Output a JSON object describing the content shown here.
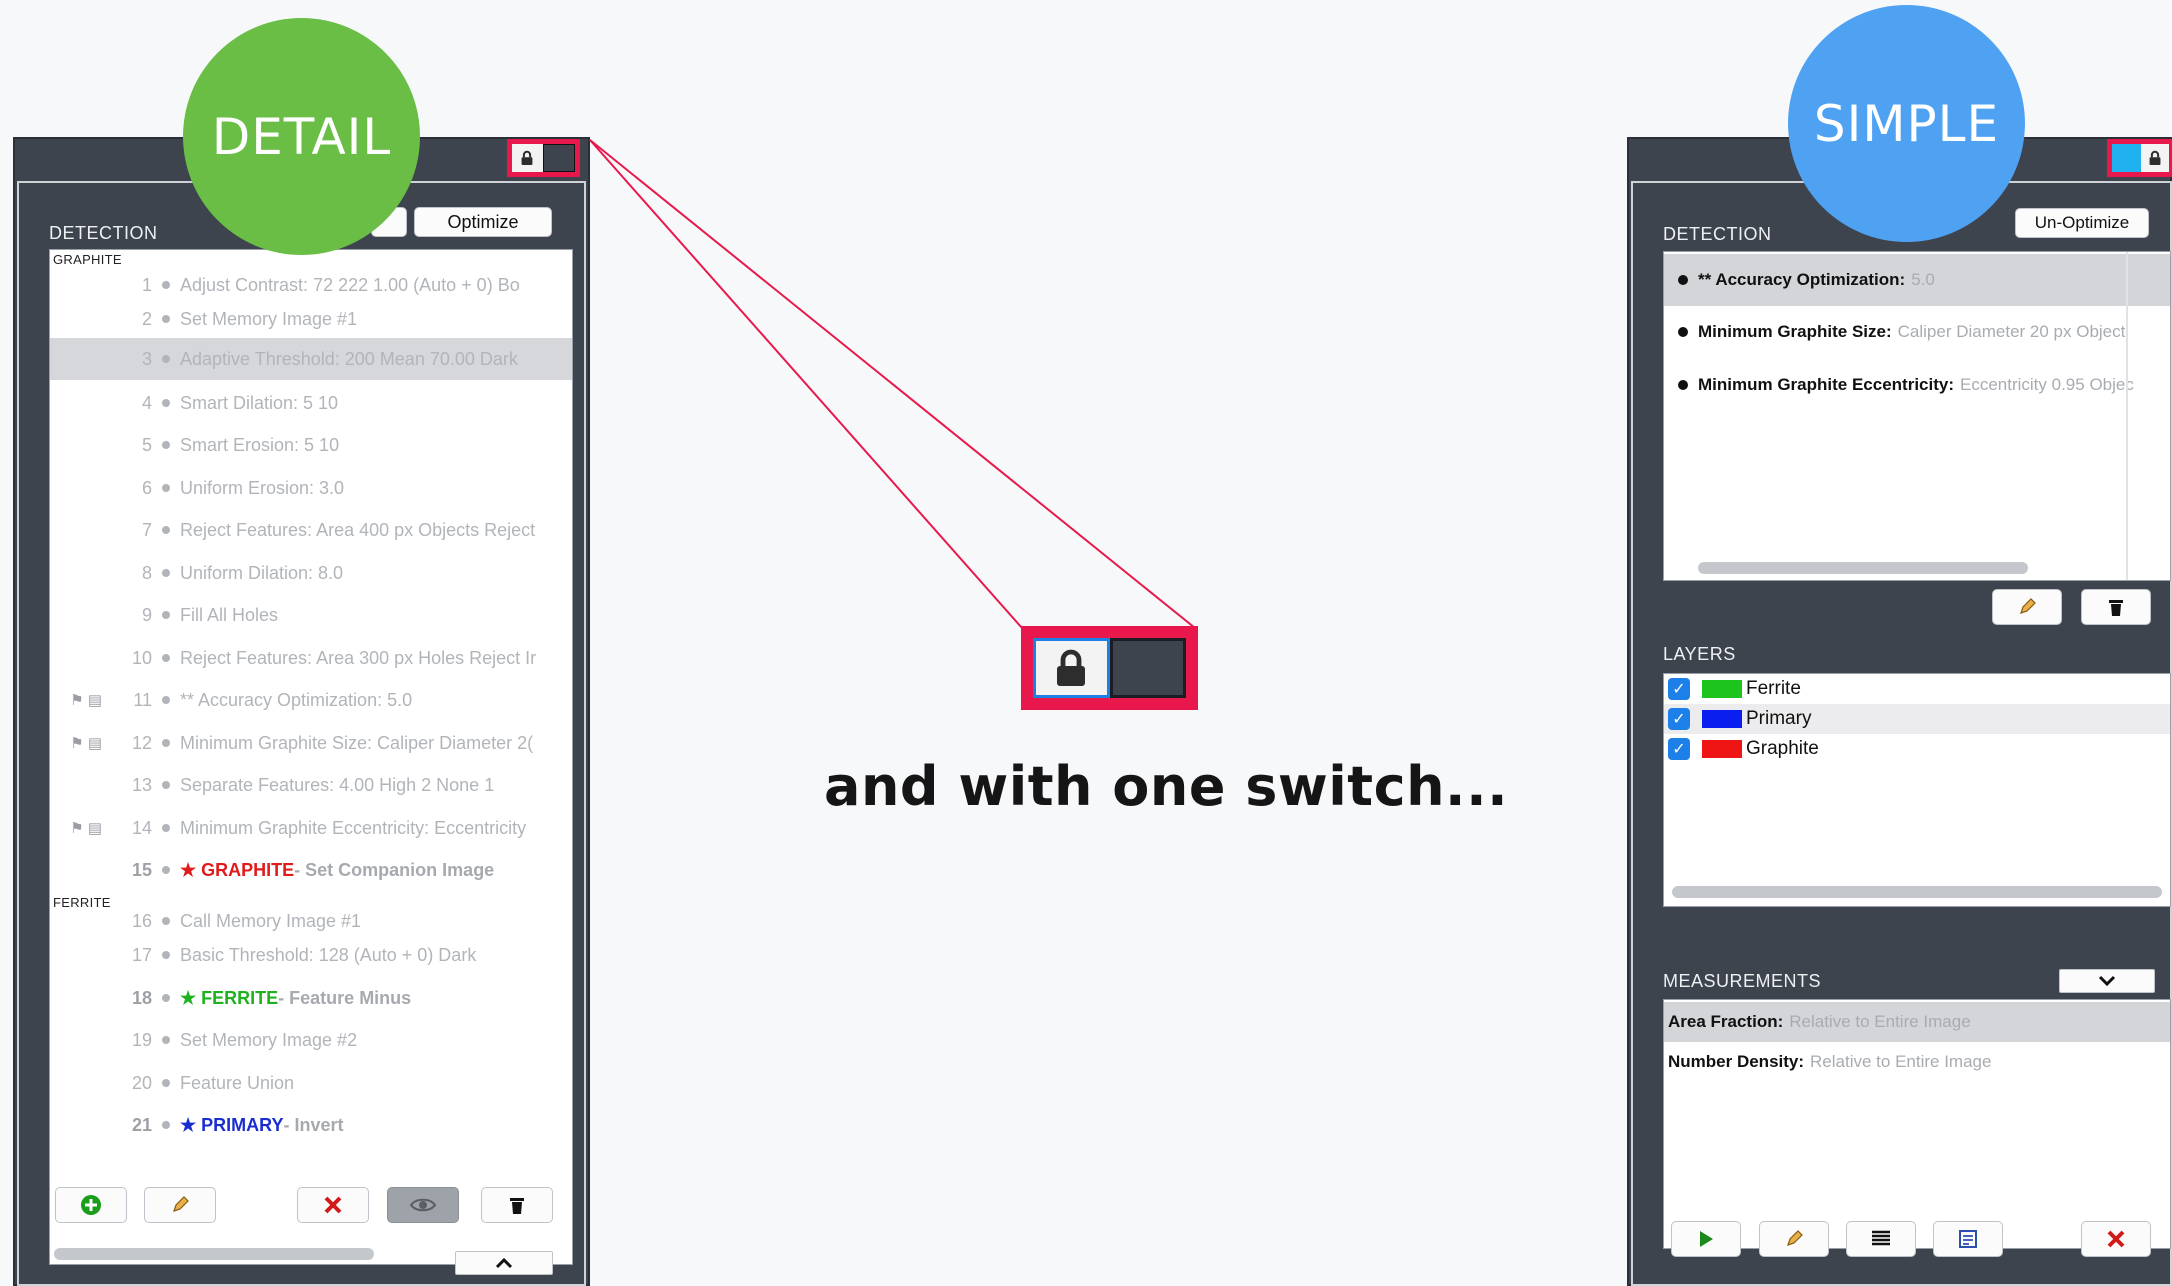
{
  "badges": {
    "detail": "DETAIL",
    "simple": "SIMPLE"
  },
  "tagline": "and with one switch...",
  "colors": {
    "accent_red": "#e8184d",
    "detail_badge": "#6abd45",
    "simple_badge": "#4fa2f2",
    "panel": "#3d444e"
  },
  "detail_panel": {
    "section_label": "DETECTION",
    "optimize_label": "Optimize",
    "groups": {
      "graphite": "GRAPHITE",
      "ferrite": "FERRITE"
    },
    "steps": [
      {
        "num": "1",
        "text": "Adjust Contrast: 72 222 1.00 (Auto + 0) Bo"
      },
      {
        "num": "2",
        "text": "Set Memory Image #1"
      },
      {
        "num": "3",
        "text": "Adaptive Threshold: 200 Mean 70.00 Dark"
      },
      {
        "num": "4",
        "text": "Smart Dilation: 5 10"
      },
      {
        "num": "5",
        "text": "Smart Erosion: 5 10"
      },
      {
        "num": "6",
        "text": "Uniform Erosion: 3.0"
      },
      {
        "num": "7",
        "text": "Reject Features: Area 400 px Objects Reject"
      },
      {
        "num": "8",
        "text": "Uniform Dilation: 8.0"
      },
      {
        "num": "9",
        "text": "Fill All Holes"
      },
      {
        "num": "10",
        "text": "Reject Features: Area 300 px Holes Reject Ir"
      },
      {
        "num": "11",
        "text": "** Accuracy Optimization: 5.0"
      },
      {
        "num": "12",
        "text": "Minimum Graphite Size: Caliper Diameter 2("
      },
      {
        "num": "13",
        "text": "Separate Features: 4.00 High 2 None 1"
      },
      {
        "num": "14",
        "text": "Minimum Graphite Eccentricity: Eccentricity"
      },
      {
        "num": "15",
        "star": "★",
        "name": "GRAPHITE",
        "text": " - Set Companion Image"
      },
      {
        "num": "16",
        "text": "Call Memory Image #1"
      },
      {
        "num": "17",
        "text": "Basic Threshold: 128 (Auto + 0) Dark"
      },
      {
        "num": "18",
        "star": "★",
        "name": "FERRITE",
        "text": " - Feature Minus"
      },
      {
        "num": "19",
        "text": "Set Memory Image #2"
      },
      {
        "num": "20",
        "text": "Feature Union"
      },
      {
        "num": "21",
        "star": "★",
        "name": "PRIMARY",
        "text": " - Invert"
      }
    ],
    "flag_glyph": "⚑ ▤",
    "icons": [
      "add-icon",
      "pencil-icon",
      "delete-x-icon",
      "eye-icon",
      "trash-icon",
      "chevron-up-icon"
    ]
  },
  "simple_panel": {
    "section_label": "DETECTION",
    "unoptimize_label": "Un-Optimize",
    "detection_items": [
      {
        "key": "** Accuracy Optimization:",
        "value": "5.0"
      },
      {
        "key": "Minimum Graphite Size:",
        "value": "Caliper Diameter 20 px Object"
      },
      {
        "key": "Minimum Graphite Eccentricity:",
        "value": "Eccentricity 0.95 Objec"
      }
    ],
    "layers_label": "LAYERS",
    "layers": [
      {
        "name": "Ferrite",
        "color": "#1ec41e"
      },
      {
        "name": "Primary",
        "color": "#0b1ef0"
      },
      {
        "name": "Graphite",
        "color": "#f01515"
      }
    ],
    "measurements_label": "MEASUREMENTS",
    "measurements": [
      {
        "key": "Area Fraction:",
        "value": "Relative to Entire Image"
      },
      {
        "key": "Number Density:",
        "value": "Relative to Entire Image"
      }
    ],
    "icons": [
      "pencil-icon",
      "trash-icon",
      "chevron-down-icon",
      "play-icon",
      "list-icon",
      "report-icon",
      "delete-x-icon"
    ]
  }
}
